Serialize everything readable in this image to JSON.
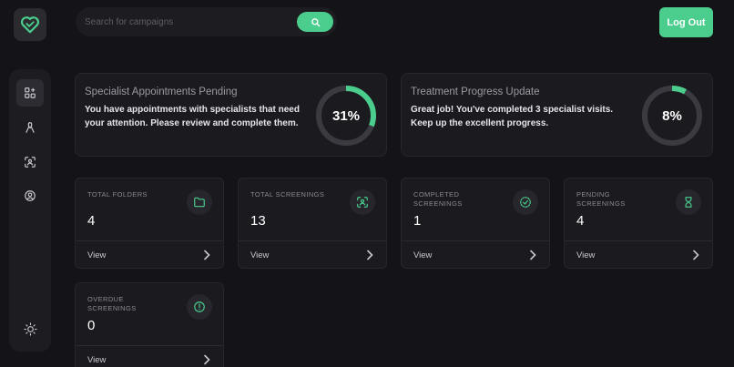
{
  "header": {
    "search_placeholder": "Search for campaigns",
    "logout_label": "Log Out"
  },
  "icons": {
    "logo": "heart-logo-icon",
    "search": "search-icon",
    "sidebar": [
      "dashboard-icon",
      "ribbon-icon",
      "scan-icon",
      "profile-icon",
      "sun-icon"
    ]
  },
  "colors": {
    "accent": "#4acd8d",
    "background": "#141418",
    "card": "#1a1a1f"
  },
  "banners": [
    {
      "title": "Specialist Appointments Pending",
      "description": "You have appointments with specialists that need your attention. Please review and complete them.",
      "percent_label": "31%",
      "progress": 0.31
    },
    {
      "title": "Treatment Progress Update",
      "description": "Great job! You've completed 3 specialist visits. Keep up the excellent progress.",
      "percent_label": "8%",
      "progress": 0.08
    }
  ],
  "stats": [
    {
      "label": "Total Folders",
      "value": "4",
      "link": "View",
      "icon": "folder-icon"
    },
    {
      "label": "Total Screenings",
      "value": "13",
      "link": "View",
      "icon": "scan-icon"
    },
    {
      "label": "Completed Screenings",
      "value": "1",
      "link": "View",
      "icon": "check-badge-icon"
    },
    {
      "label": "Pending Screenings",
      "value": "4",
      "link": "View",
      "icon": "hourglass-icon"
    },
    {
      "label": "Overdue Screenings",
      "value": "0",
      "link": "View",
      "icon": "alert-icon"
    }
  ]
}
